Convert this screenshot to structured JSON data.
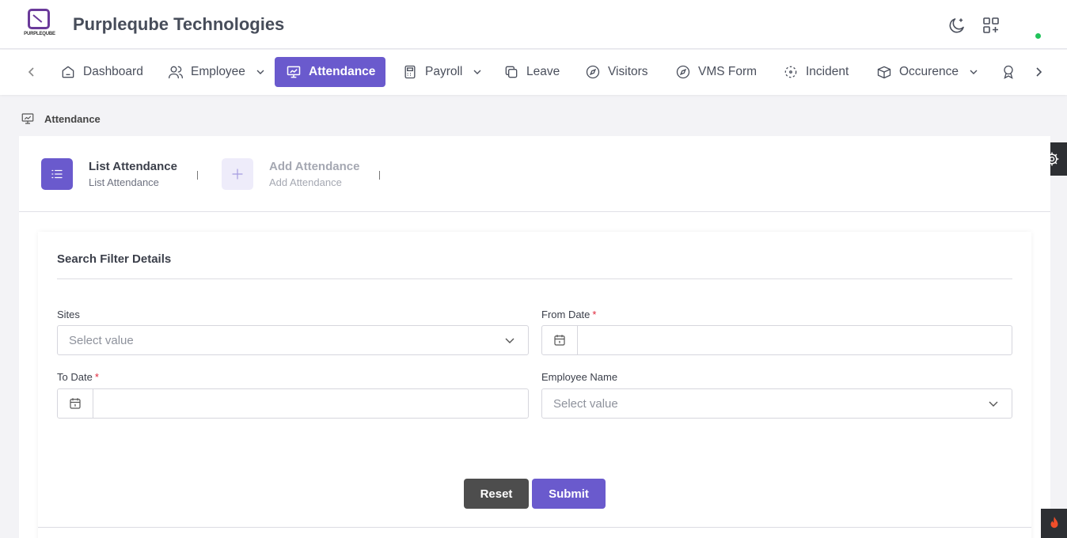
{
  "header": {
    "logo_text": "PURPLEQUBE",
    "brand": "Purpleqube Technologies",
    "status_color": "#21c35a"
  },
  "nav": {
    "items": [
      {
        "label": "Dashboard",
        "icon": "home-icon"
      },
      {
        "label": "Employee",
        "icon": "users-icon"
      },
      {
        "label": "Attendance",
        "icon": "presentation-icon"
      },
      {
        "label": "Payroll",
        "icon": "calculator-icon"
      },
      {
        "label": "Leave",
        "icon": "copy-icon"
      },
      {
        "label": "Visitors",
        "icon": "compass-icon"
      },
      {
        "label": "VMS Form",
        "icon": "compass-icon"
      },
      {
        "label": "Incident",
        "icon": "focus-icon"
      },
      {
        "label": "Occurence",
        "icon": "box-icon"
      }
    ],
    "active": "Attendance",
    "accent_color": "#6a5acd"
  },
  "breadcrumb": {
    "label": "Attendance"
  },
  "tabs": [
    {
      "title": "List Attendance",
      "subtitle": "List Attendance"
    },
    {
      "title": "Add Attendance",
      "subtitle": "Add Attendance"
    }
  ],
  "filter": {
    "title": "Search Filter Details",
    "sites_label": "Sites",
    "sites_placeholder": "Select value",
    "from_date_label": "From Date",
    "to_date_label": "To Date",
    "employee_label": "Employee Name",
    "employee_placeholder": "Select value",
    "required_mark": "*",
    "reset_label": "Reset",
    "submit_label": "Submit"
  }
}
